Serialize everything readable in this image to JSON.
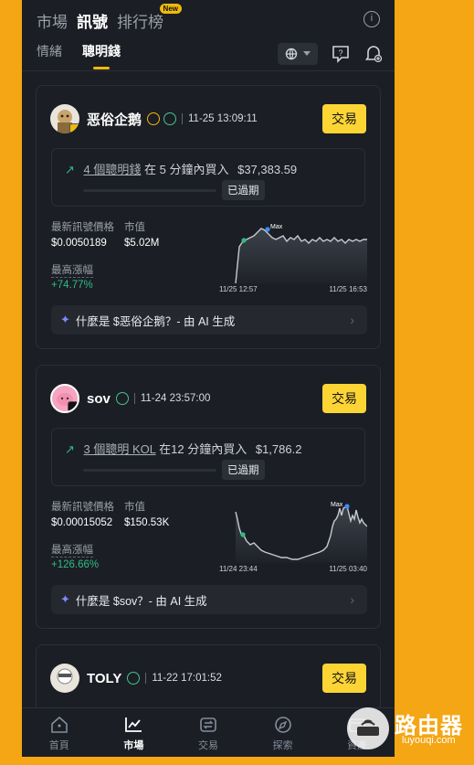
{
  "header": {
    "tabs": [
      {
        "label": "市場"
      },
      {
        "label": "訊號"
      },
      {
        "label": "排行榜"
      }
    ],
    "new_badge": "New",
    "info_icon": "i"
  },
  "subtabs": [
    {
      "label": "情緒"
    },
    {
      "label": "聰明錢"
    }
  ],
  "cards": [
    {
      "name": "恶俗企鹅",
      "time": "11-25 13:09:11",
      "trade_label": "交易",
      "signal_link": "4 個聰明錢",
      "signal_text": "在 5 分鐘內買入",
      "signal_amount": "$37,383.59",
      "status": "已過期",
      "price_label": "最新訊號價格",
      "price": "$0.0050189",
      "mcap_label": "市值",
      "mcap": "$5.02M",
      "gain_label": "最高漲幅",
      "gain": "+74.77%",
      "max_label": "Max",
      "chart_start": "11/25 12:57",
      "chart_end": "11/25 16:53",
      "ai_text": "什麼是 $恶俗企鹅？- 由 AI 生成"
    },
    {
      "name": "sov",
      "time": "11-24 23:57:00",
      "trade_label": "交易",
      "signal_link": "3 個聰明 KOL",
      "signal_text": "在12 分鐘內買入",
      "signal_amount": "$1,786.2",
      "status": "已過期",
      "price_label": "最新訊號價格",
      "price": "$0.00015052",
      "mcap_label": "市值",
      "mcap": "$150.53K",
      "gain_label": "最高漲幅",
      "gain": "+126.66%",
      "max_label": "Max",
      "chart_start": "11/24 23:44",
      "chart_end": "11/25 03:40",
      "ai_text": "什麼是 $sov？- 由 AI 生成"
    },
    {
      "name": "TOLY",
      "time": "11-22 17:01:52",
      "trade_label": "交易"
    }
  ],
  "nav": [
    {
      "label": "首頁",
      "icon": "home-icon"
    },
    {
      "label": "市場",
      "icon": "market-icon"
    },
    {
      "label": "交易",
      "icon": "trade-icon"
    },
    {
      "label": "探索",
      "icon": "explore-icon"
    },
    {
      "label": "資產",
      "icon": "assets-icon"
    }
  ],
  "watermark": {
    "title": "路由器",
    "sub": "luyouqi.com"
  },
  "colors": {
    "accent": "#fcd535",
    "gain": "#2ebd85",
    "bg": "#1b1e24"
  }
}
